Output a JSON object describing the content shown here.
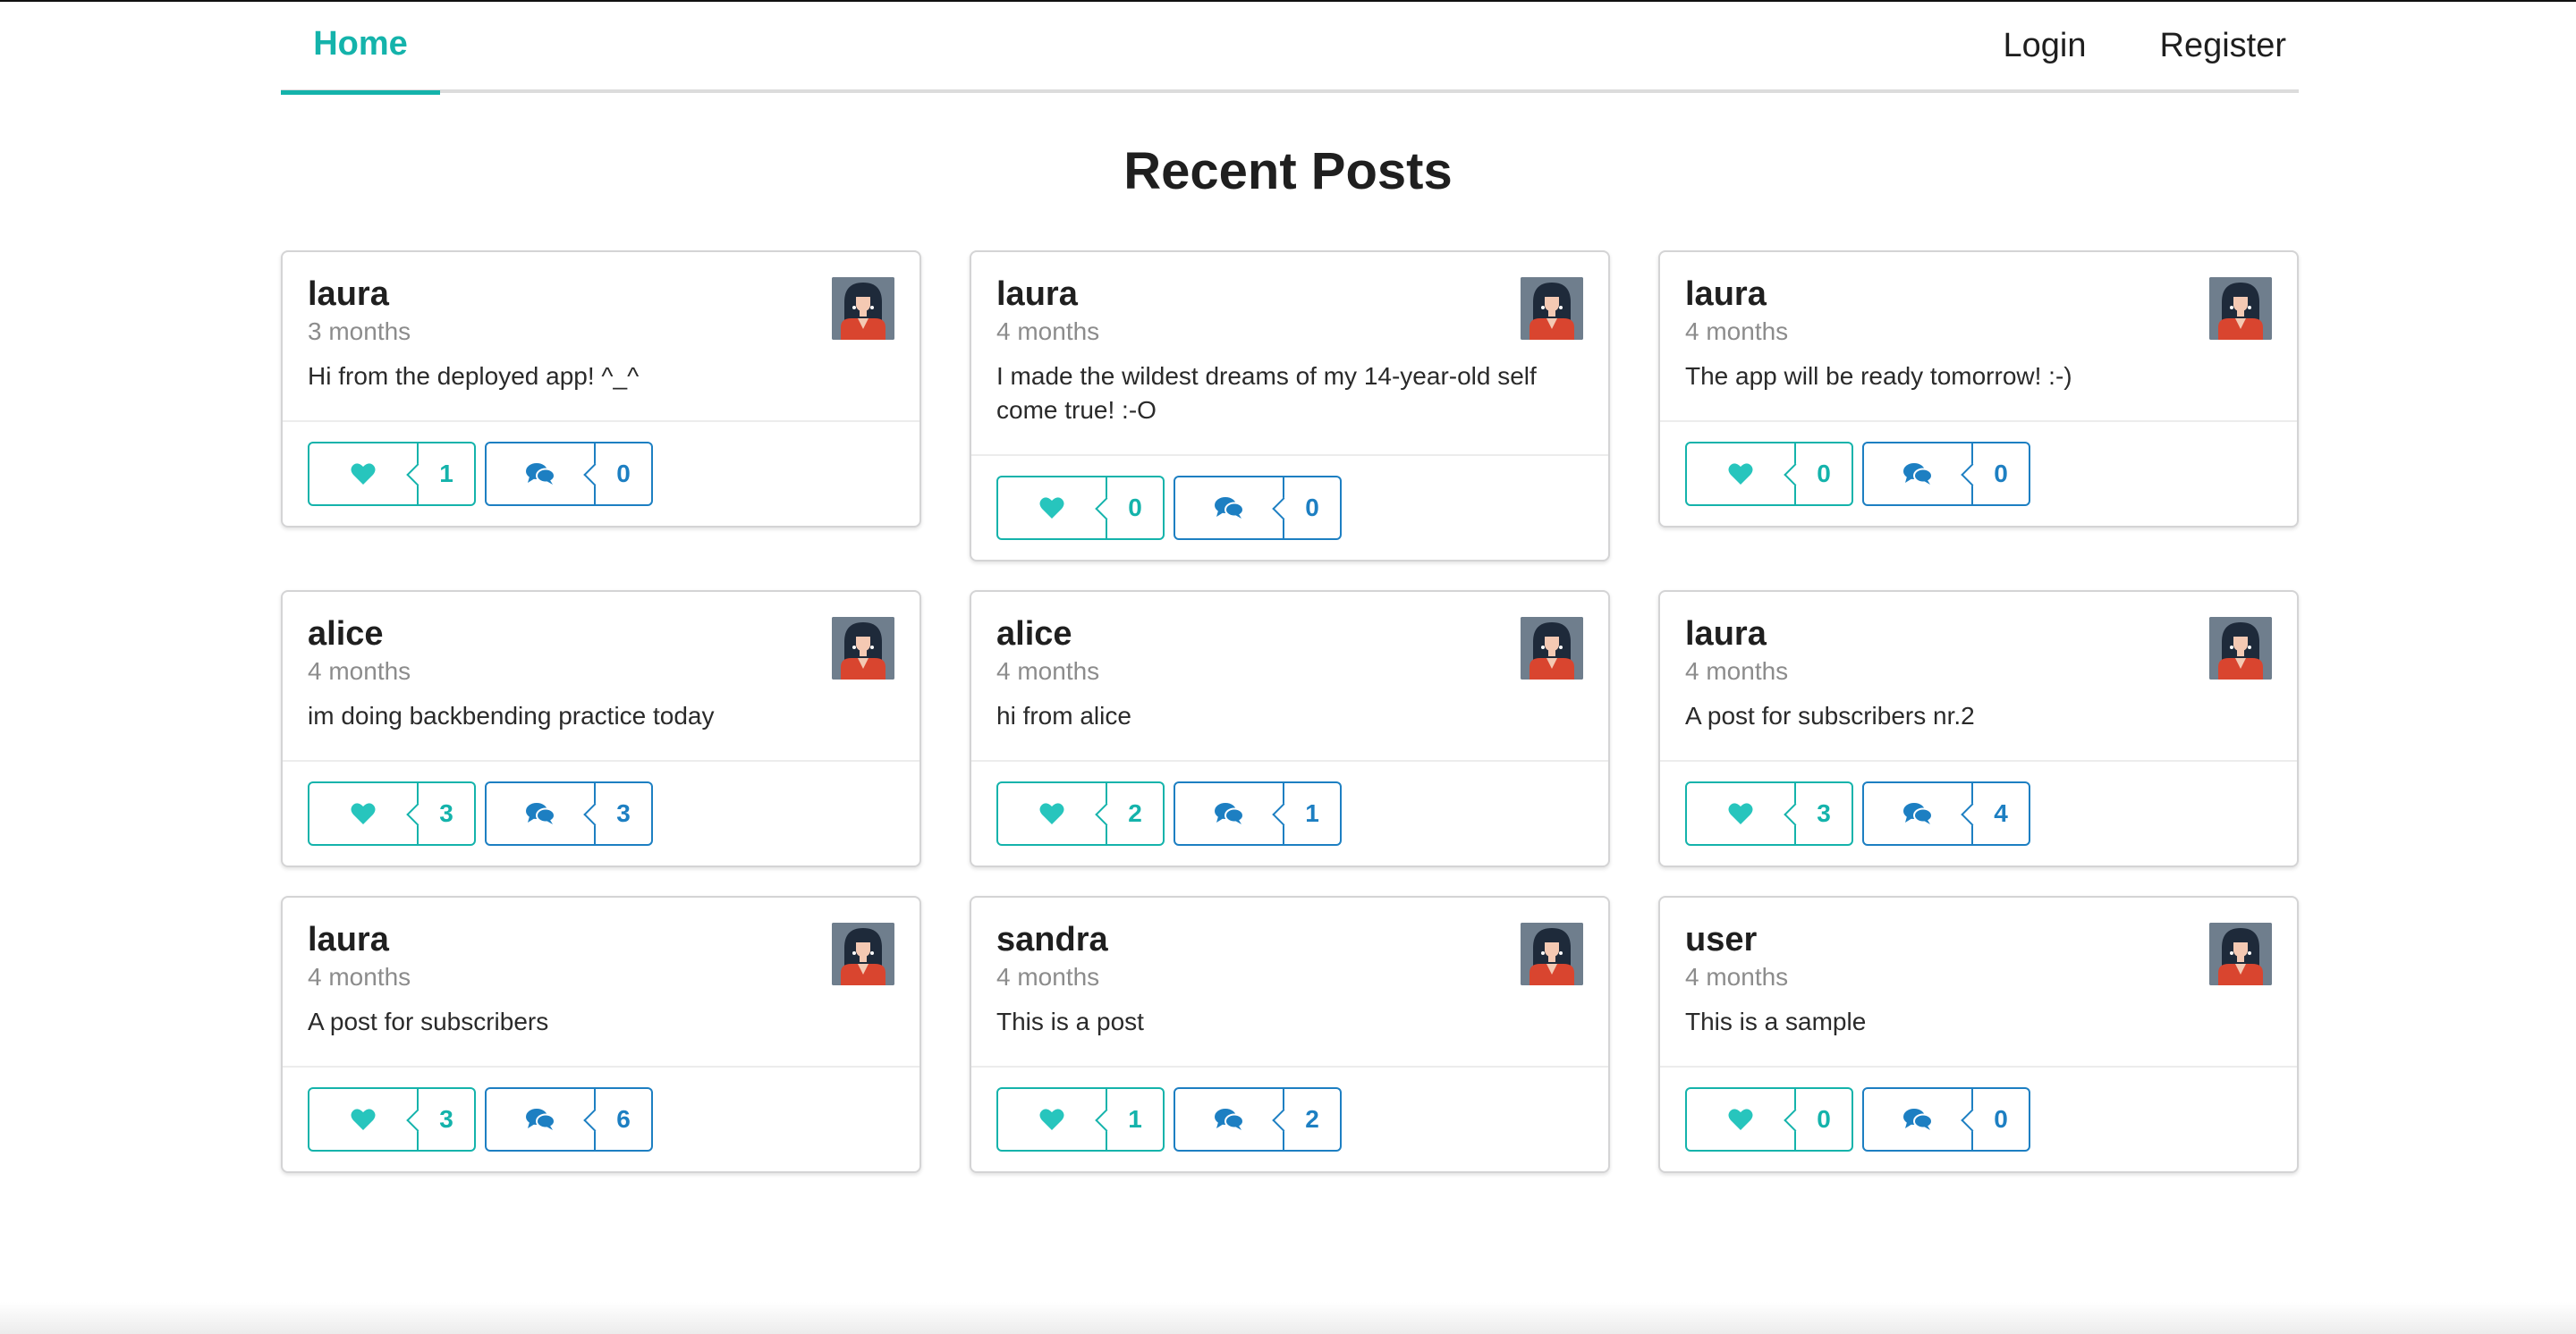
{
  "nav": {
    "home_label": "Home",
    "login_label": "Login",
    "register_label": "Register"
  },
  "page_title": "Recent Posts",
  "colors": {
    "accent": "#14b3ab",
    "comment": "#1d7fc2",
    "text": "#1f1f1f",
    "muted": "#8c8c8c"
  },
  "posts": [
    {
      "author": "laura",
      "time": "3 months",
      "body": "Hi from the deployed app! ^_^",
      "likes": "1",
      "comments": "0"
    },
    {
      "author": "laura",
      "time": "4 months",
      "body": "I made the wildest dreams of my 14-year-old self come true! :-O",
      "likes": "0",
      "comments": "0"
    },
    {
      "author": "laura",
      "time": "4 months",
      "body": "The app will be ready tomorrow! :-)",
      "likes": "0",
      "comments": "0"
    },
    {
      "author": "alice",
      "time": "4 months",
      "body": "im doing backbending practice today",
      "likes": "3",
      "comments": "3"
    },
    {
      "author": "alice",
      "time": "4 months",
      "body": "hi from alice",
      "likes": "2",
      "comments": "1"
    },
    {
      "author": "laura",
      "time": "4 months",
      "body": "A post for subscribers nr.2",
      "likes": "3",
      "comments": "4"
    },
    {
      "author": "laura",
      "time": "4 months",
      "body": "A post for subscribers",
      "likes": "3",
      "comments": "6"
    },
    {
      "author": "sandra",
      "time": "4 months",
      "body": "This is a post",
      "likes": "1",
      "comments": "2"
    },
    {
      "author": "user",
      "time": "4 months",
      "body": "This is a sample",
      "likes": "0",
      "comments": "0"
    }
  ],
  "icons": {
    "like": "heart-icon",
    "comment": "comments-icon",
    "avatar": "avatar-image"
  }
}
